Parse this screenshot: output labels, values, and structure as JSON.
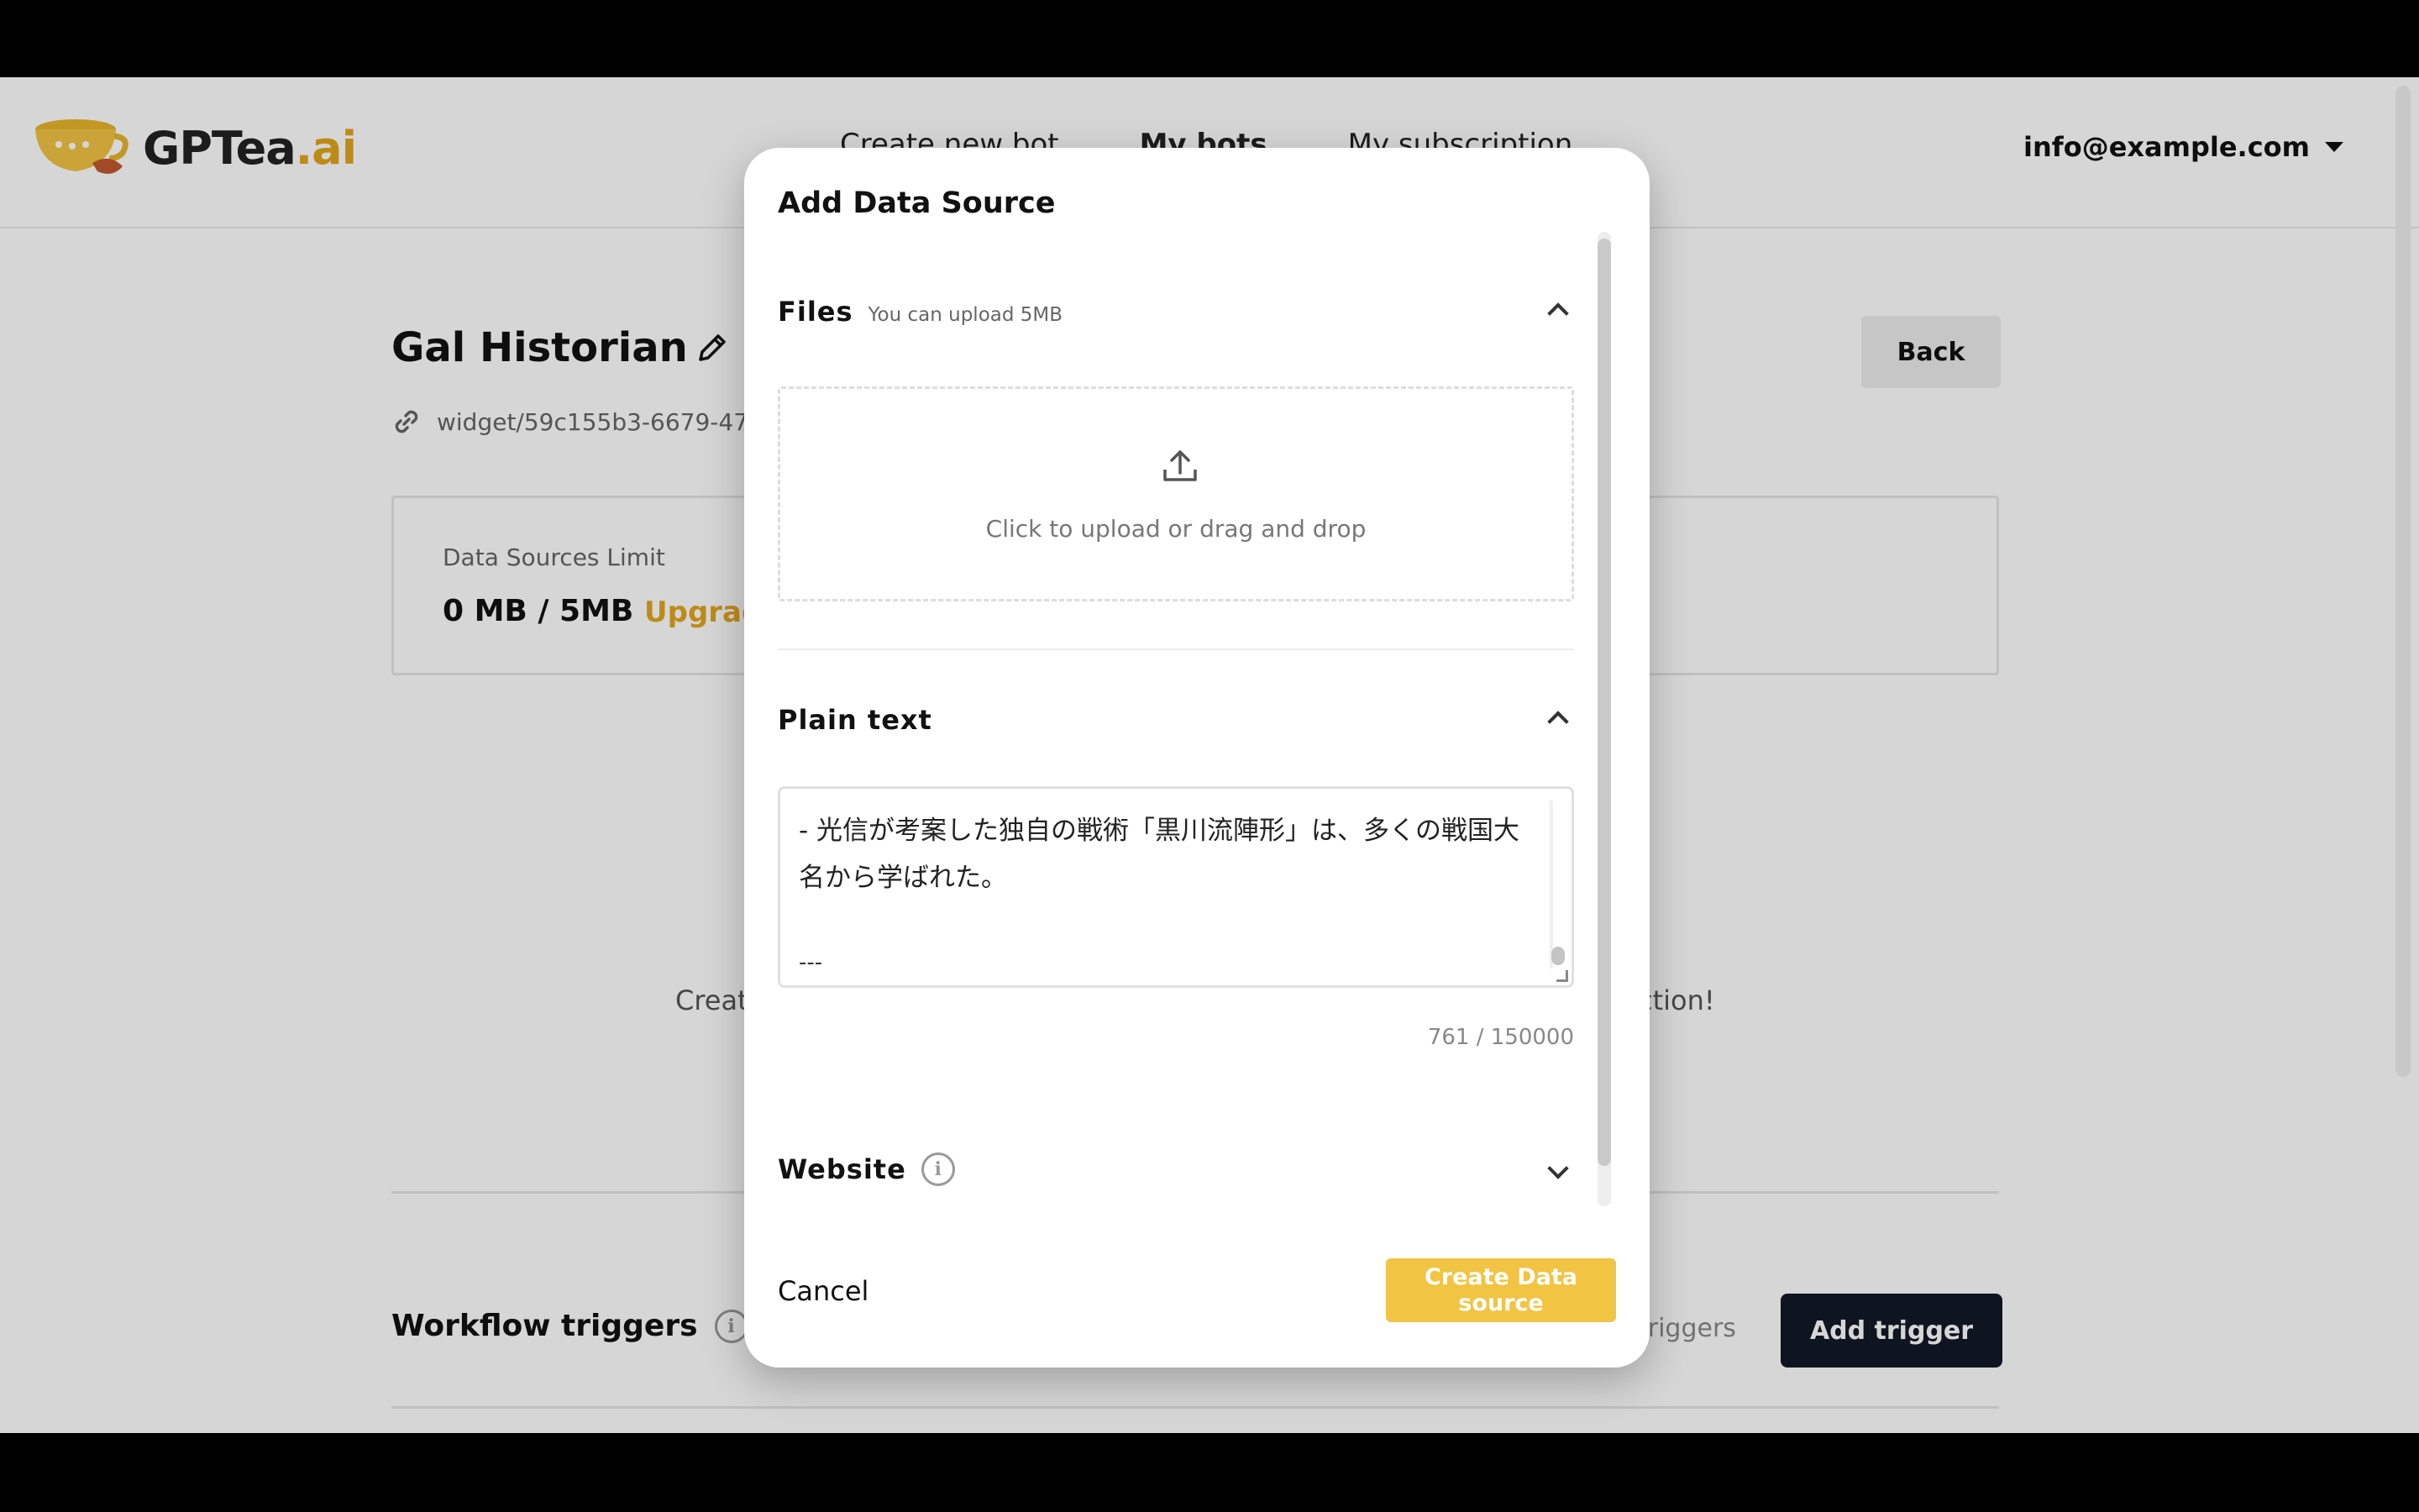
{
  "brand": {
    "name_main": "GPTea",
    "name_accent": ".ai"
  },
  "nav": {
    "items": [
      "Create new bot",
      "My bots",
      "My subscription"
    ],
    "active": "My bots"
  },
  "user": {
    "email": "info@example.com"
  },
  "bot": {
    "title": "Gal Historian",
    "widget_path": "widget/59c155b3-6679-477",
    "back_label": "Back"
  },
  "limits": {
    "label": "Data Sources Limit",
    "value": "0 MB / 5MB",
    "upgrade_label": "Upgrad"
  },
  "empty_state": {
    "left_fragment": "Creat",
    "right_fragment": "ction!"
  },
  "workflow": {
    "title": "Workflow triggers",
    "side_fragment": "triggers",
    "add_label": "Add trigger"
  },
  "modal": {
    "title": "Add Data Source",
    "files": {
      "name": "Files",
      "note": "You can upload 5MB",
      "upload_text": "Click to upload or drag and drop"
    },
    "plain_text": {
      "name": "Plain text",
      "content": "- 光信が考案した独自の戦術「黒川流陣形」は、多くの戦国大名から学ばれた。",
      "separator": "---",
      "counter": "761 / 150000"
    },
    "website": {
      "name": "Website"
    },
    "cancel_label": "Cancel",
    "create_label": "Create Data source"
  },
  "colors": {
    "accent": "#e2a61d",
    "create_button": "#f1c443",
    "dark_button": "#111a27"
  }
}
